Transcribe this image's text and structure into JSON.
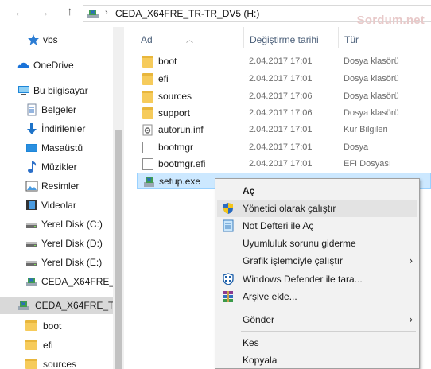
{
  "address": {
    "path": "CEDA_X64FRE_TR-TR_DV5 (H:)",
    "separator": "›",
    "back_icon": "arrow-left-icon",
    "forward_icon": "arrow-right-icon",
    "up_icon": "arrow-up-icon"
  },
  "watermark": "Sordum.net",
  "nav": {
    "items": [
      {
        "label": "vbs",
        "icon": "pinned-star-icon"
      },
      {
        "label": "OneDrive",
        "icon": "onedrive-cloud-icon"
      },
      {
        "label": "Bu bilgisayar",
        "icon": "computer-icon"
      },
      {
        "label": "Belgeler",
        "icon": "documents-icon"
      },
      {
        "label": "İndirilenler",
        "icon": "downloads-icon"
      },
      {
        "label": "Masaüstü",
        "icon": "desktop-icon"
      },
      {
        "label": "Müzikler",
        "icon": "music-icon"
      },
      {
        "label": "Resimler",
        "icon": "pictures-icon"
      },
      {
        "label": "Videolar",
        "icon": "videos-icon"
      },
      {
        "label": "Yerel Disk (C:)",
        "icon": "drive-icon"
      },
      {
        "label": "Yerel Disk (D:)",
        "icon": "drive-icon"
      },
      {
        "label": "Yerel Disk (E:)",
        "icon": "drive-icon"
      },
      {
        "label": "CEDA_X64FRE_T",
        "icon": "dvd-drive-icon"
      },
      {
        "label": "CEDA_X64FRE_TR-",
        "icon": "dvd-drive-icon"
      },
      {
        "label": "boot",
        "icon": "folder-icon"
      },
      {
        "label": "efi",
        "icon": "folder-icon"
      },
      {
        "label": "sources",
        "icon": "folder-icon"
      }
    ]
  },
  "columns": {
    "name": "Ad",
    "date": "Değiştirme tarihi",
    "type": "Tür"
  },
  "files": [
    {
      "name": "boot",
      "date": "2.04.2017 17:01",
      "type": "Dosya klasörü",
      "icon": "folder-icon"
    },
    {
      "name": "efi",
      "date": "2.04.2017 17:01",
      "type": "Dosya klasörü",
      "icon": "folder-icon"
    },
    {
      "name": "sources",
      "date": "2.04.2017 17:06",
      "type": "Dosya klasörü",
      "icon": "folder-icon"
    },
    {
      "name": "support",
      "date": "2.04.2017 17:06",
      "type": "Dosya klasörü",
      "icon": "folder-icon"
    },
    {
      "name": "autorun.inf",
      "date": "2.04.2017 17:01",
      "type": "Kur Bilgileri",
      "icon": "settings-file-icon"
    },
    {
      "name": "bootmgr",
      "date": "2.04.2017 17:01",
      "type": "Dosya",
      "icon": "file-icon"
    },
    {
      "name": "bootmgr.efi",
      "date": "2.04.2017 17:01",
      "type": "EFI Dosyası",
      "icon": "file-icon"
    },
    {
      "name": "setup.exe",
      "date": "",
      "type": "",
      "icon": "setup-exe-icon"
    }
  ],
  "context_menu": {
    "items": [
      {
        "label": "Aç",
        "icon": "",
        "bold": true,
        "submenu": false
      },
      {
        "label": "Yönetici olarak çalıştır",
        "icon": "uac-shield-icon",
        "bold": false,
        "submenu": false
      },
      {
        "label": "Not Defteri ile Aç",
        "icon": "notepad-icon",
        "bold": false,
        "submenu": false
      },
      {
        "label": "Uyumluluk sorunu giderme",
        "icon": "",
        "bold": false,
        "submenu": false
      },
      {
        "label": "Grafik işlemciyle çalıştır",
        "icon": "",
        "bold": false,
        "submenu": true
      },
      {
        "label": "Windows Defender ile tara...",
        "icon": "defender-icon",
        "bold": false,
        "submenu": false
      },
      {
        "label": "Arşive ekle...",
        "icon": "winrar-icon",
        "bold": false,
        "submenu": false
      },
      {
        "label": "Gönder",
        "icon": "",
        "bold": false,
        "submenu": true
      },
      {
        "label": "Kes",
        "icon": "",
        "bold": false,
        "submenu": false
      },
      {
        "label": "Kopyala",
        "icon": "",
        "bold": false,
        "submenu": false
      }
    ],
    "submenu_glyph": "›"
  },
  "colors": {
    "selection": "#cce8ff",
    "menu_highlight": "#e3e3e3",
    "folder": "#f6cb5b",
    "header_text": "#4c607a"
  }
}
